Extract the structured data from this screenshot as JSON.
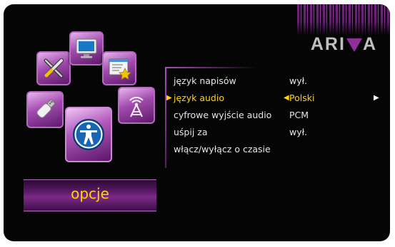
{
  "brand": {
    "logo_prefix": "ARI",
    "logo_suffix": "A"
  },
  "page": {
    "title": "opcje"
  },
  "icons": [
    {
      "name": "tools-icon"
    },
    {
      "name": "tv-monitor-icon"
    },
    {
      "name": "favorites-window-icon"
    },
    {
      "name": "usb-stick-icon"
    },
    {
      "name": "accessibility-person-icon"
    },
    {
      "name": "antenna-tower-icon"
    }
  ],
  "menu": {
    "items": [
      {
        "label": "język napisów",
        "value": "wył."
      },
      {
        "label": "język audio",
        "value": "Polski",
        "selected": true
      },
      {
        "label": "cyfrowe wyjście audio",
        "value": "PCM"
      },
      {
        "label": "uśpij za",
        "value": "wył."
      },
      {
        "label": "włącz/wyłącz o czasie",
        "value": ""
      }
    ]
  },
  "colors": {
    "accent": "#ffd400",
    "frame": "#050505",
    "purple": "#8f2f9a"
  }
}
